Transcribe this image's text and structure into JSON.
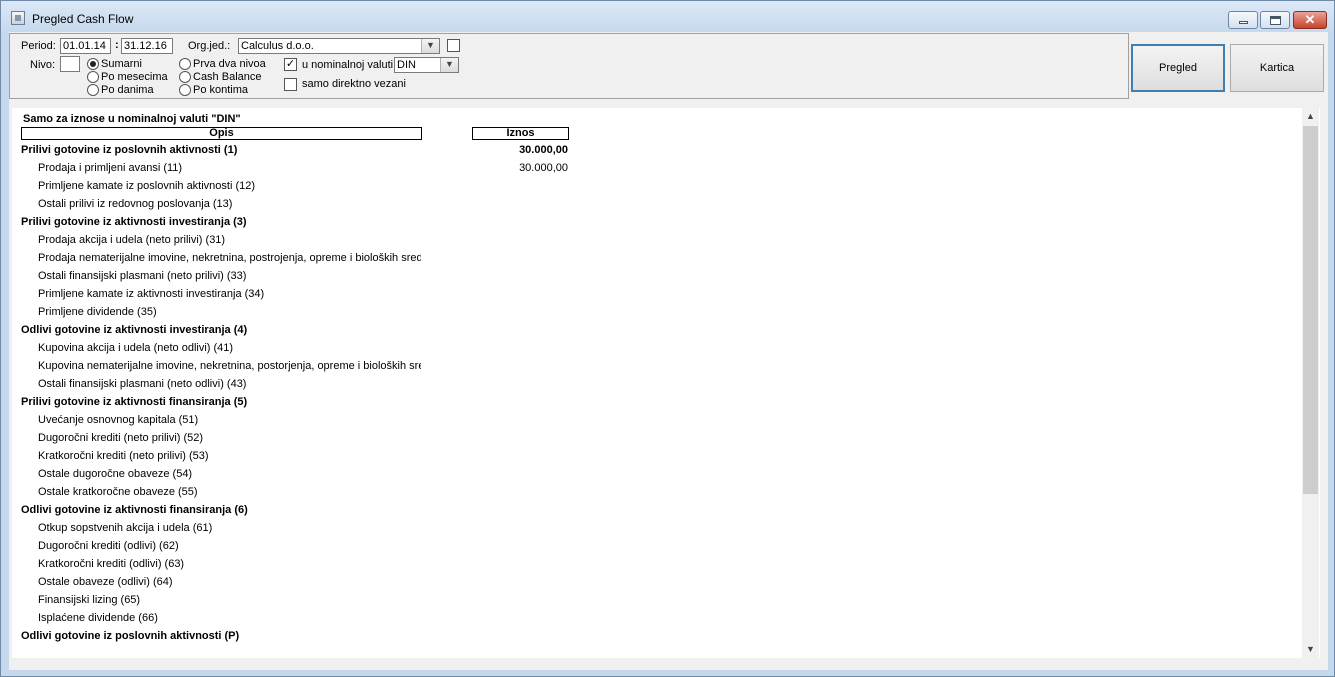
{
  "window": {
    "title": "Pregled Cash Flow"
  },
  "params": {
    "period_label": "Period:",
    "date_from": "01.01.14",
    "date_sep": ":",
    "date_to": "31.12.16",
    "org_label": "Org.jed.:",
    "org_value": "Calculus d.o.o.",
    "nivo_label": "Nivo:",
    "nivo_value": "",
    "radios_col1": [
      "Sumarni",
      "Po mesecima",
      "Po danima"
    ],
    "radios_col2": [
      "Prva dva nivoa",
      "Cash Balance",
      "Po kontima"
    ],
    "selected_radio": "Sumarni",
    "nominal_label": "u nominalnoj valuti",
    "nominal_checked": true,
    "currency": "DIN",
    "direct_label": "samo direktno vezani",
    "direct_checked": false,
    "extra_checked": false
  },
  "buttons": {
    "pregled": "Pregled",
    "kartica": "Kartica"
  },
  "report": {
    "note": "Samo za iznose u nominalnoj valuti \"DIN\"",
    "col_opis": "Opis",
    "col_iznos": "Iznos",
    "rows": [
      {
        "desc": "Prilivi gotovine iz poslovnih aktivnosti (1)",
        "amount": "30.000,00",
        "bold": true
      },
      {
        "desc": "Prodaja i primljeni avansi (11)",
        "amount": "30.000,00",
        "bold": false
      },
      {
        "desc": "Primljene kamate iz poslovnih aktivnosti (12)",
        "amount": "",
        "bold": false
      },
      {
        "desc": "Ostali prilivi iz redovnog poslovanja (13)",
        "amount": "",
        "bold": false
      },
      {
        "desc": "Prilivi gotovine iz aktivnosti investiranja (3)",
        "amount": "",
        "bold": true
      },
      {
        "desc": "Prodaja akcija i udela (neto prilivi) (31)",
        "amount": "",
        "bold": false
      },
      {
        "desc": "Prodaja nematerijalne imovine, nekretnina, postrojenja, opreme i bioloških sreds",
        "amount": "",
        "bold": false
      },
      {
        "desc": "Ostali finansijski plasmani (neto prilivi) (33)",
        "amount": "",
        "bold": false
      },
      {
        "desc": "Primljene kamate iz aktivnosti investiranja (34)",
        "amount": "",
        "bold": false
      },
      {
        "desc": "Primljene dividende (35)",
        "amount": "",
        "bold": false
      },
      {
        "desc": "Odlivi gotovine iz aktivnosti investiranja (4)",
        "amount": "",
        "bold": true
      },
      {
        "desc": "Kupovina akcija i udela (neto odlivi) (41)",
        "amount": "",
        "bold": false
      },
      {
        "desc": "Kupovina nematerijalne imovine, nekretnina, postorjenja, opreme i bioloških sre",
        "amount": "",
        "bold": false
      },
      {
        "desc": "Ostali finansijski plasmani (neto odlivi) (43)",
        "amount": "",
        "bold": false
      },
      {
        "desc": "Prilivi gotovine iz aktivnosti finansiranja (5)",
        "amount": "",
        "bold": true
      },
      {
        "desc": "Uvećanje osnovnog kapitala (51)",
        "amount": "",
        "bold": false
      },
      {
        "desc": "Dugoročni krediti (neto prilivi) (52)",
        "amount": "",
        "bold": false
      },
      {
        "desc": "Kratkoročni krediti (neto prilivi) (53)",
        "amount": "",
        "bold": false
      },
      {
        "desc": "Ostale dugoročne obaveze (54)",
        "amount": "",
        "bold": false
      },
      {
        "desc": "Ostale kratkoročne obaveze (55)",
        "amount": "",
        "bold": false
      },
      {
        "desc": "Odlivi gotovine iz aktivnosti finansiranja (6)",
        "amount": "",
        "bold": true
      },
      {
        "desc": "Otkup sopstvenih akcija i udela (61)",
        "amount": "",
        "bold": false
      },
      {
        "desc": "Dugoročni krediti (odlivi) (62)",
        "amount": "",
        "bold": false
      },
      {
        "desc": "Kratkoročni krediti (odlivi) (63)",
        "amount": "",
        "bold": false
      },
      {
        "desc": "Ostale obaveze (odlivi) (64)",
        "amount": "",
        "bold": false
      },
      {
        "desc": "Finansijski lizing (65)",
        "amount": "",
        "bold": false
      },
      {
        "desc": "Isplaćene dividende (66)",
        "amount": "",
        "bold": false
      },
      {
        "desc": "Odlivi gotovine iz poslovnih aktivnosti (P)",
        "amount": "",
        "bold": true
      }
    ]
  }
}
